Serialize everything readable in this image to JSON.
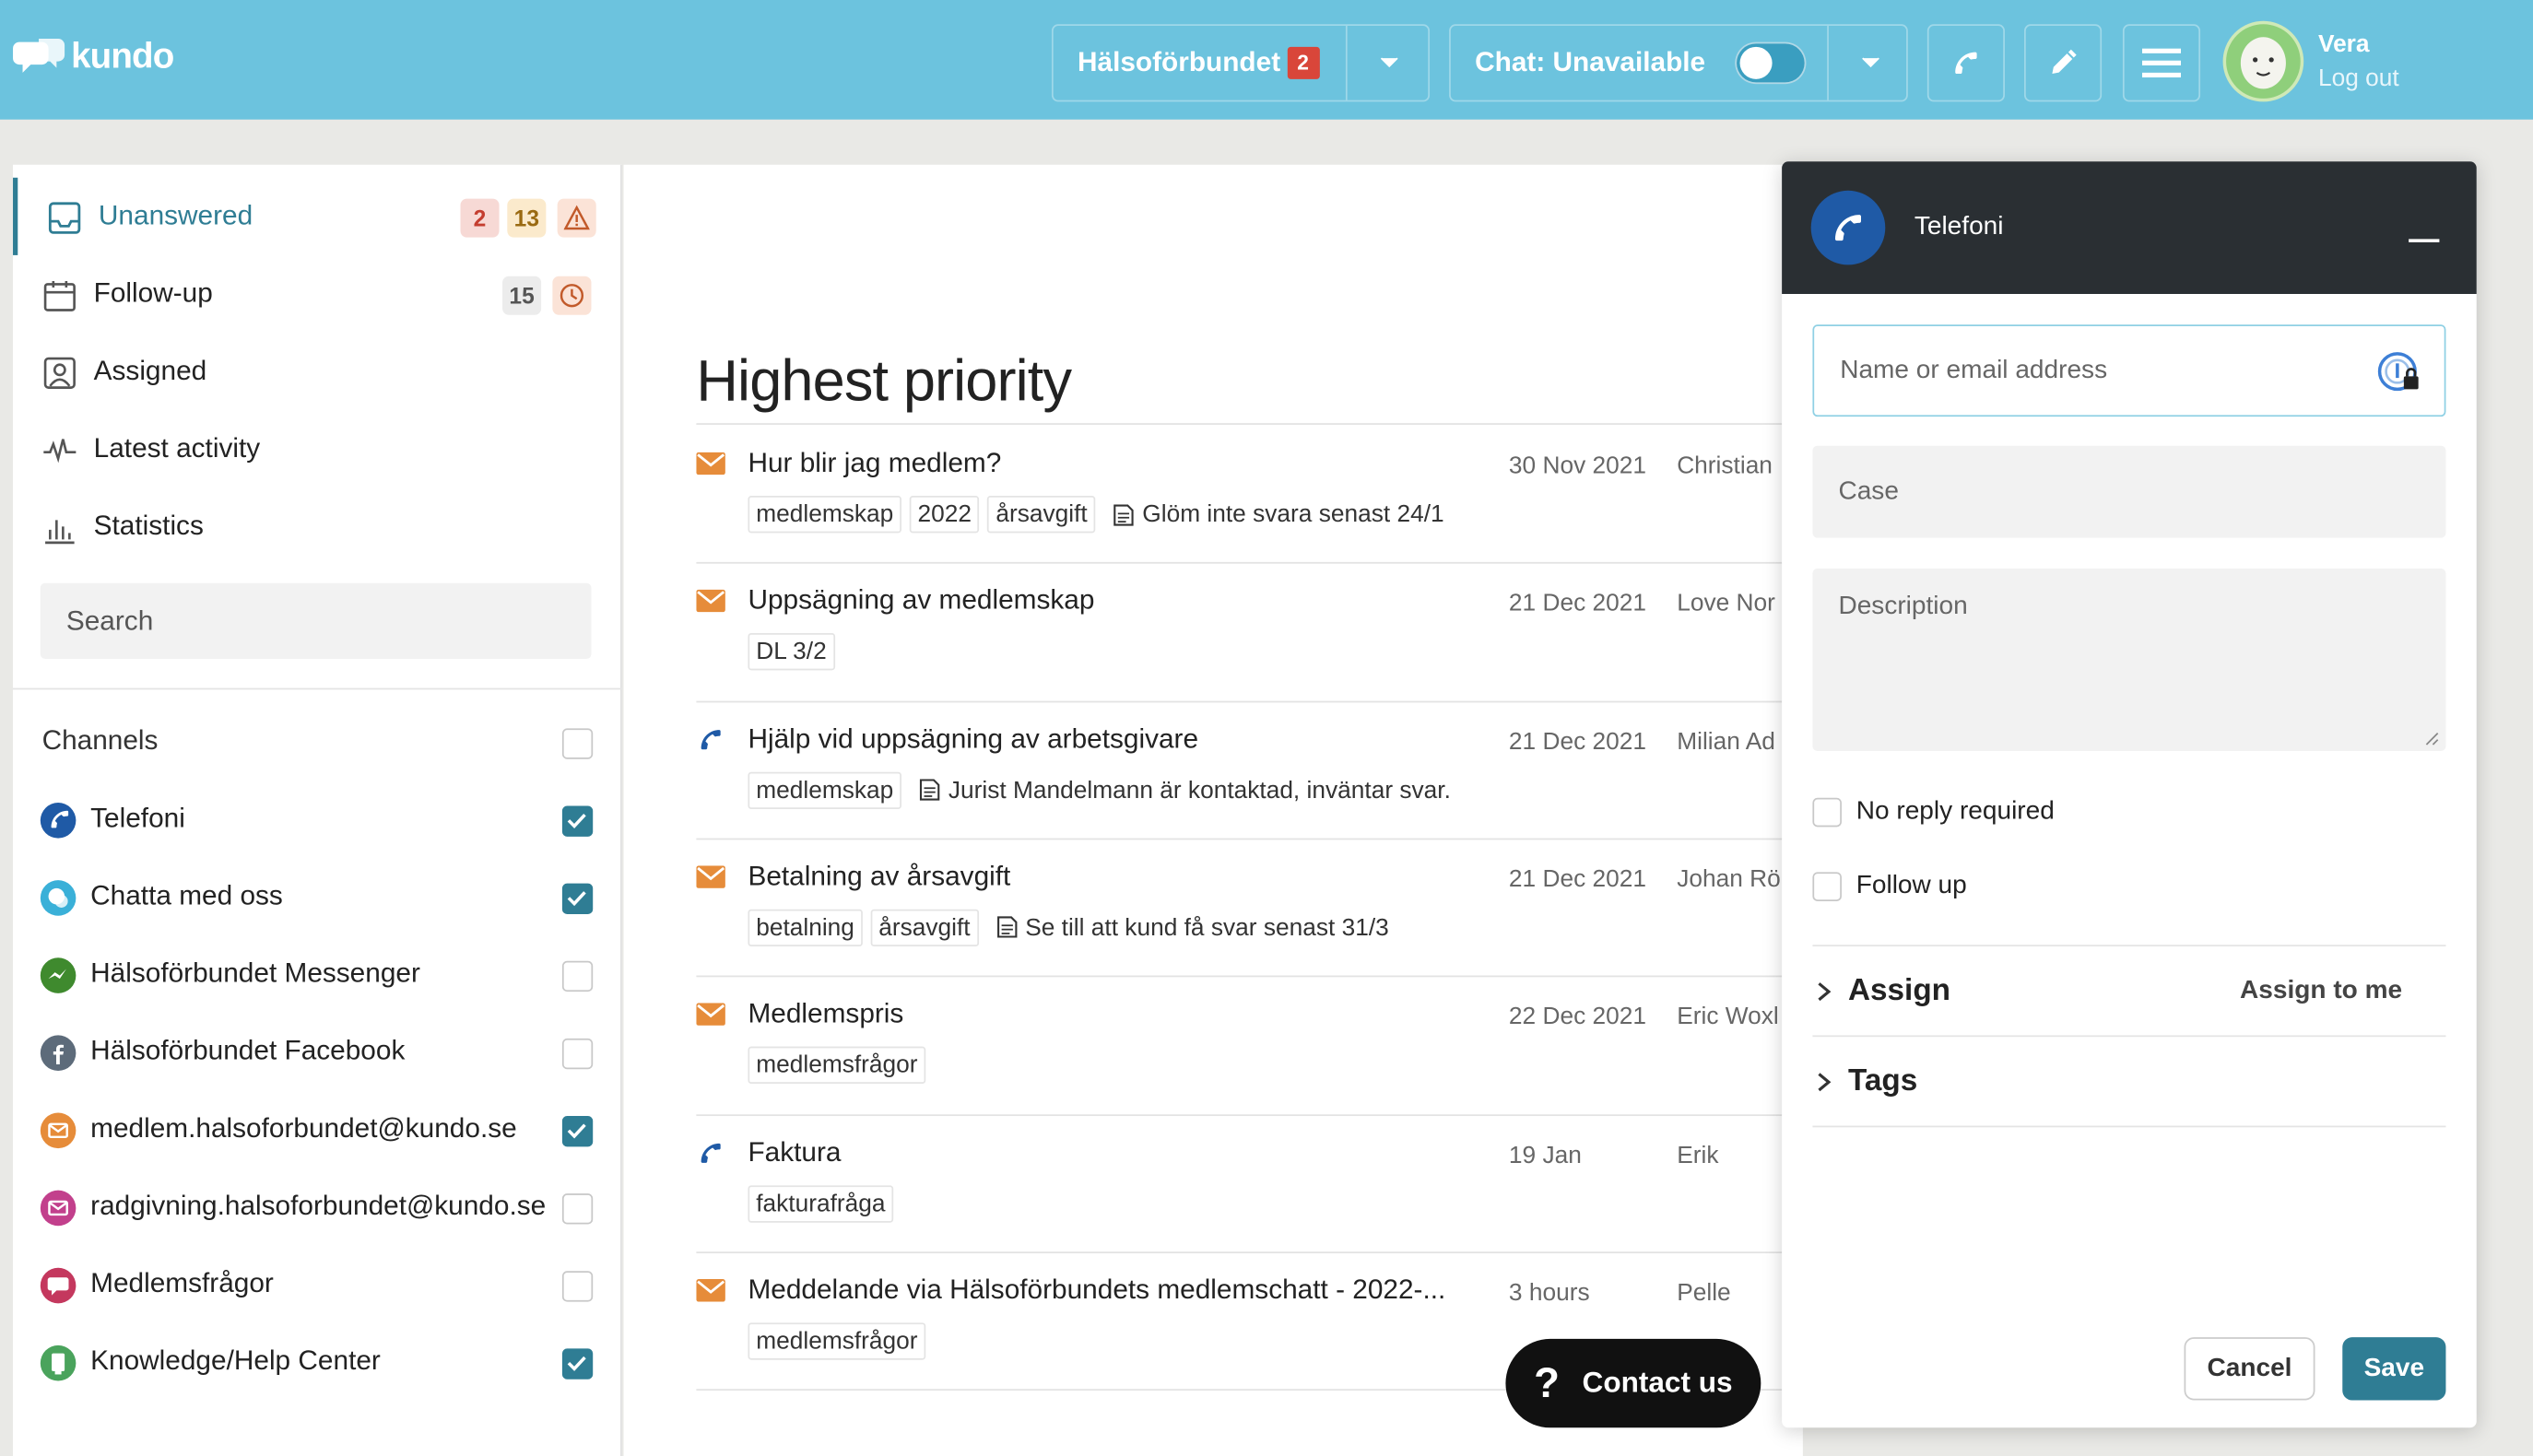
{
  "header": {
    "logo_text": "kundo",
    "org_name": "Hälsoförbundet",
    "org_badge": "2",
    "chat_status": "Chat: Unavailable",
    "user_name": "Vera",
    "logout": "Log out"
  },
  "sidebar": {
    "nav": [
      {
        "label": "Unanswered",
        "badges": [
          "2",
          "13"
        ],
        "active": true,
        "icon": "inbox-icon"
      },
      {
        "label": "Follow-up",
        "badges": [
          "15"
        ],
        "icon": "calendar-icon"
      },
      {
        "label": "Assigned",
        "icon": "assigned-icon"
      },
      {
        "label": "Latest activity",
        "icon": "activity-icon"
      },
      {
        "label": "Statistics",
        "icon": "statistics-icon"
      }
    ],
    "search_placeholder": "Search",
    "channels_heading": "Channels",
    "channels": [
      {
        "label": "Telefoni",
        "checked": true,
        "color": "#1f5aa6",
        "icon": "phone-icon"
      },
      {
        "label": "Chatta med oss",
        "checked": true,
        "color": "#3ab0d8",
        "icon": "chat-icon"
      },
      {
        "label": "Hälsoförbundet Messenger",
        "checked": false,
        "color": "#3f8a2e",
        "icon": "messenger-icon"
      },
      {
        "label": "Hälsoförbundet Facebook",
        "checked": false,
        "color": "#5d6b7a",
        "icon": "facebook-icon"
      },
      {
        "label": "medlem.halsoforbundet@kundo.se",
        "checked": true,
        "color": "#e68c3a",
        "icon": "email-icon"
      },
      {
        "label": "radgivning.halsoforbundet@kundo.se",
        "checked": false,
        "color": "#c2408c",
        "icon": "email-icon"
      },
      {
        "label": "Medlemsfrågor",
        "checked": false,
        "color": "#c4385e",
        "icon": "forum-icon"
      },
      {
        "label": "Knowledge/Help Center",
        "checked": true,
        "color": "#4aa35c",
        "icon": "knowledge-icon"
      }
    ]
  },
  "main": {
    "heading": "Highest priority",
    "rows": [
      {
        "type": "email",
        "title": "Hur blir jag medlem?",
        "date": "30 Nov 2021",
        "name": "Christian",
        "tags": [
          "medlemskap",
          "2022",
          "årsavgift"
        ],
        "note": "Glöm inte svara senast 24/1"
      },
      {
        "type": "email",
        "title": "Uppsägning av medlemskap",
        "date": "21 Dec 2021",
        "name": "Love Nor",
        "tags": [
          "DL 3/2"
        ],
        "note": ""
      },
      {
        "type": "phone",
        "title": "Hjälp vid uppsägning av arbetsgivare",
        "date": "21 Dec 2021",
        "name": "Milian Ad",
        "tags": [
          "medlemskap"
        ],
        "note": "Jurist Mandelmann är kontaktad, inväntar svar."
      },
      {
        "type": "email",
        "title": "Betalning av årsavgift",
        "date": "21 Dec 2021",
        "name": "Johan Rö",
        "tags": [
          "betalning",
          "årsavgift"
        ],
        "note": "Se till att kund få svar senast 31/3"
      },
      {
        "type": "email",
        "title": "Medlemspris",
        "date": "22 Dec 2021",
        "name": "Eric Woxl",
        "tags": [
          "medlemsfrågor"
        ],
        "note": ""
      },
      {
        "type": "phone",
        "title": "Faktura",
        "date": "19 Jan",
        "name": "Erik",
        "tags": [
          "fakturafråga"
        ],
        "note": ""
      },
      {
        "type": "email",
        "title": "Meddelande via Hälsoförbundets medlemschatt - 2022-...",
        "date": "3 hours",
        "name": "Pelle",
        "tags": [
          "medlemsfrågor"
        ],
        "note": ""
      }
    ]
  },
  "contact_button": "Contact us",
  "panel": {
    "title": "Telefoni",
    "name_placeholder": "Name or email address",
    "case_placeholder": "Case",
    "description_placeholder": "Description",
    "no_reply": "No reply required",
    "follow_up": "Follow up",
    "assign": "Assign",
    "assign_to_me": "Assign to me",
    "tags": "Tags",
    "cancel": "Cancel",
    "save": "Save"
  },
  "colors": {
    "header": "#6cc3de",
    "accent": "#2f7d94",
    "panel_header": "#2a2f33"
  }
}
